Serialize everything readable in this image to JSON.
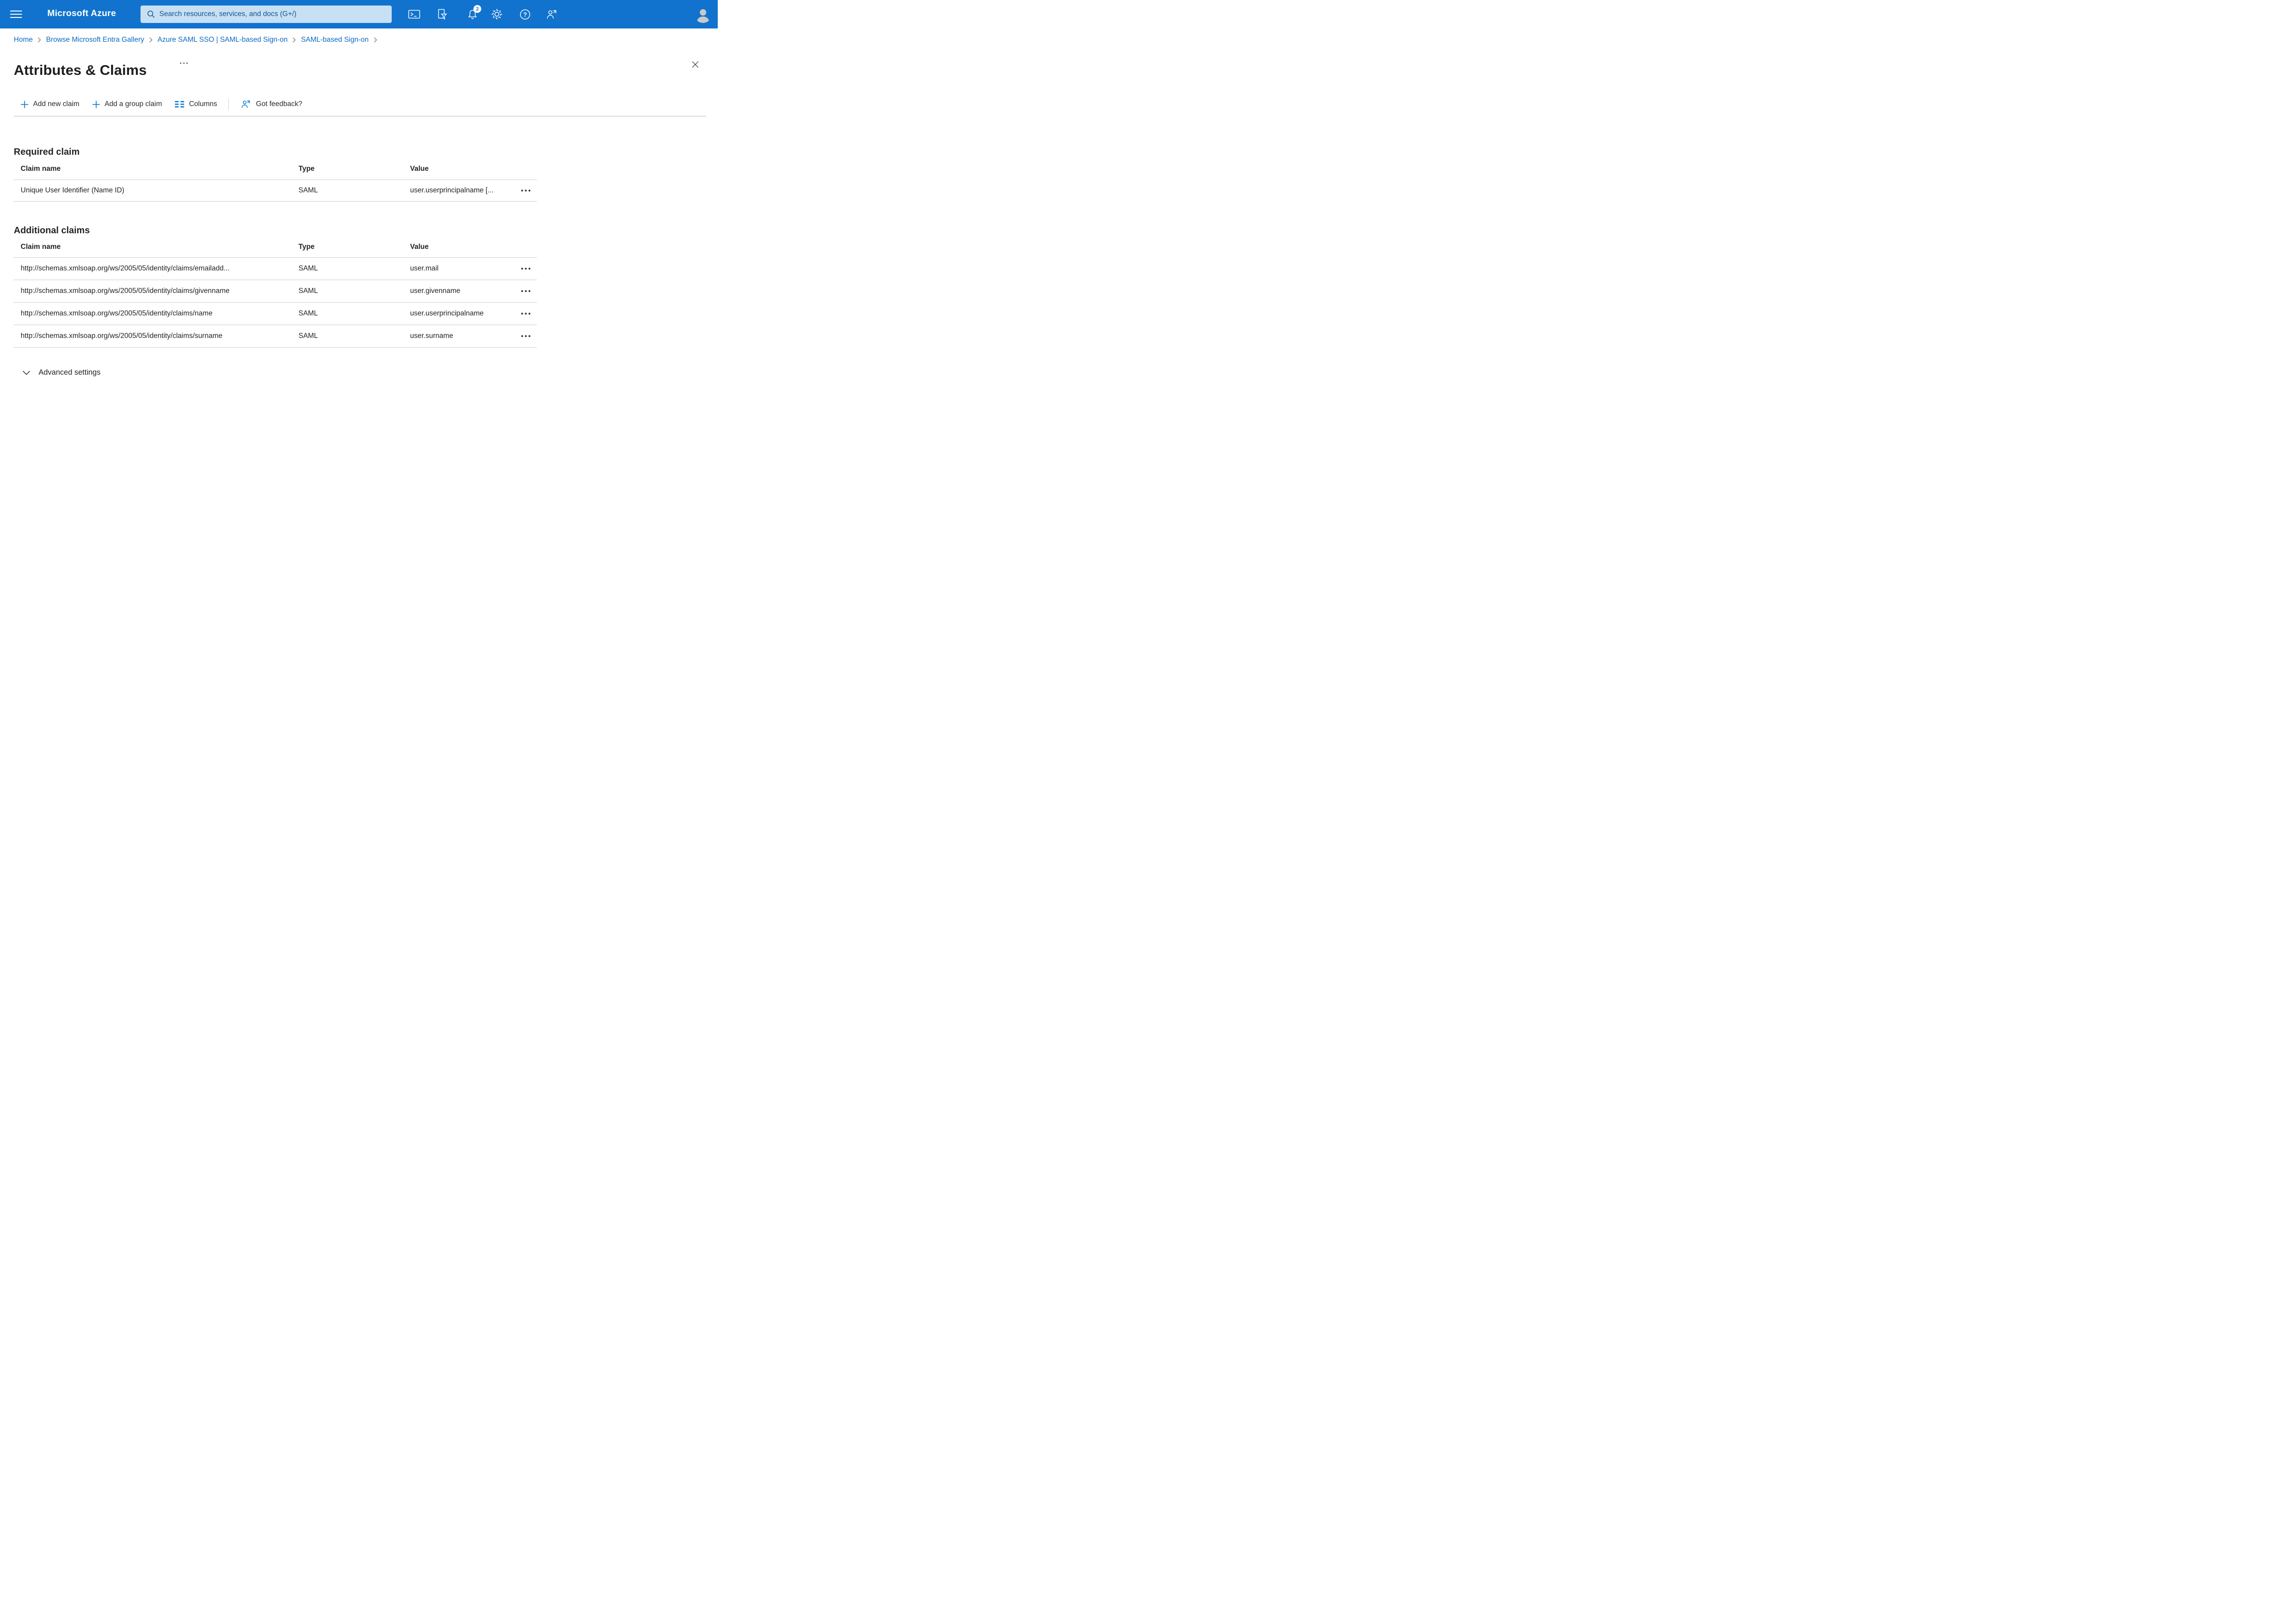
{
  "topbar": {
    "product": "Microsoft Azure",
    "search_placeholder": "Search resources, services, and docs (G+/)",
    "notification_count": "2"
  },
  "breadcrumb": {
    "items": [
      "Home",
      "Browse Microsoft Entra Gallery",
      "Azure SAML SSO | SAML-based Sign-on",
      "SAML-based Sign-on"
    ]
  },
  "page": {
    "title": "Attributes & Claims"
  },
  "toolbar": {
    "add_new_claim": "Add new claim",
    "add_group_claim": "Add a group claim",
    "columns": "Columns",
    "got_feedback": "Got feedback?"
  },
  "required_claim": {
    "section_title": "Required claim",
    "columns": {
      "claim_name": "Claim name",
      "type": "Type",
      "value": "Value"
    },
    "rows": [
      {
        "claim_name": "Unique User Identifier (Name ID)",
        "type": "SAML",
        "value": "user.userprincipalname [..."
      }
    ]
  },
  "additional_claims": {
    "section_title": "Additional claims",
    "columns": {
      "claim_name": "Claim name",
      "type": "Type",
      "value": "Value"
    },
    "rows": [
      {
        "claim_name": "http://schemas.xmlsoap.org/ws/2005/05/identity/claims/emailadd...",
        "type": "SAML",
        "value": "user.mail"
      },
      {
        "claim_name": "http://schemas.xmlsoap.org/ws/2005/05/identity/claims/givenname",
        "type": "SAML",
        "value": "user.givenname"
      },
      {
        "claim_name": "http://schemas.xmlsoap.org/ws/2005/05/identity/claims/name",
        "type": "SAML",
        "value": "user.userprincipalname"
      },
      {
        "claim_name": "http://schemas.xmlsoap.org/ws/2005/05/identity/claims/surname",
        "type": "SAML",
        "value": "user.surname"
      }
    ]
  },
  "advanced_settings": {
    "label": "Advanced settings"
  },
  "colors": {
    "topbar_blue": "#1173cd",
    "search_bg": "#c7e0f4",
    "search_text": "#14538f",
    "link_blue": "#0c6ac2",
    "accent_blue": "#0078d4",
    "text": "#252423",
    "divider": "#cfcdcb"
  }
}
